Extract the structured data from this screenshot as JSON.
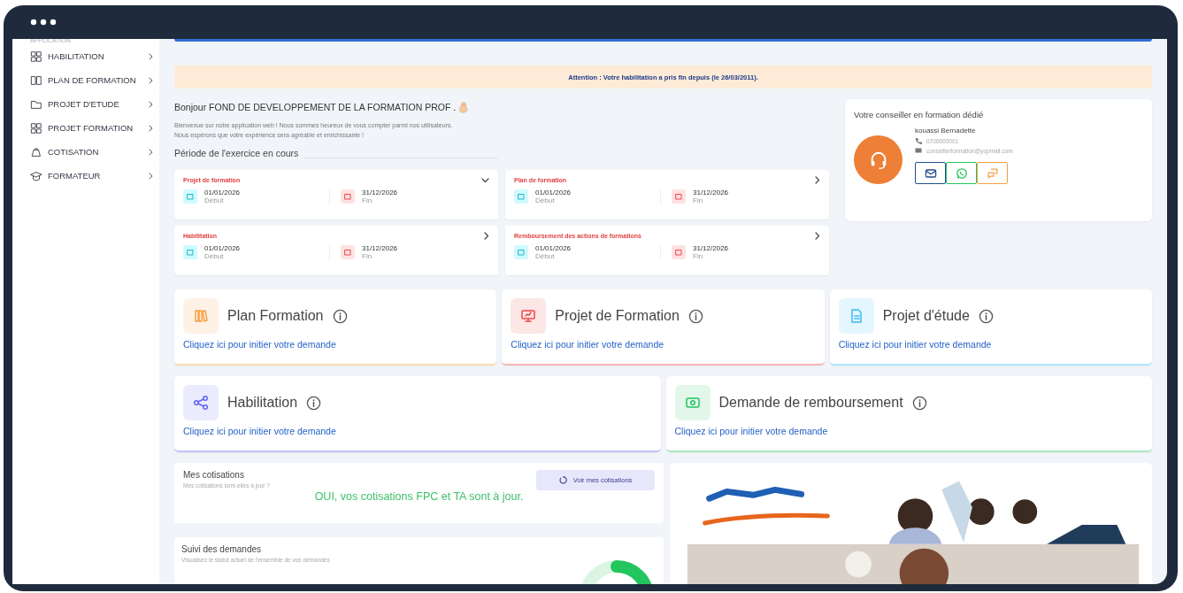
{
  "sidebar": {
    "section": "APPLICATION",
    "items": [
      {
        "label": "HABILITATION"
      },
      {
        "label": "PLAN DE FORMATION"
      },
      {
        "label": "PROJET D'ETUDE"
      },
      {
        "label": "PROJET FORMATION"
      },
      {
        "label": "COTISATION"
      },
      {
        "label": "FORMATEUR"
      }
    ]
  },
  "alert": "Attention : Votre habilitation a pris fin depuis (le 26/03/2011).",
  "greeting": {
    "title": "Bonjour FOND DE DEVELOPPEMENT DE LA FORMATION PROF .",
    "lines": [
      "Bienvenue sur notre application web ! Nous sommes heureux de vous compter parmi nos utilisateurs.",
      "Nous espérons que votre expérience sera agréable et enrichissante !"
    ]
  },
  "period": {
    "title": "Période de l'exercice en cours",
    "cards": [
      {
        "title": "Projet de formation",
        "expanded": true,
        "start": "01/01/2026",
        "start_label": "Début",
        "end": "31/12/2026",
        "end_label": "Fin"
      },
      {
        "title": "Plan de formation",
        "expanded": false,
        "start": "01/01/2026",
        "start_label": "Début",
        "end": "31/12/2026",
        "end_label": "Fin"
      },
      {
        "title": "Habilitation",
        "expanded": false,
        "start": "01/01/2026",
        "start_label": "Début",
        "end": "31/12/2026",
        "end_label": "Fin"
      },
      {
        "title": "Remboursement des actions de formations",
        "expanded": false,
        "start": "01/01/2026",
        "start_label": "Début",
        "end": "31/12/2026",
        "end_label": "Fin"
      }
    ]
  },
  "advisor": {
    "title": "Votre conseiller en formation dédié",
    "name": "kouassi Bernadette",
    "phone": "0700000001",
    "email": "conseillerformation@yopmail.com"
  },
  "actions": [
    {
      "title": "Plan Formation",
      "link": "Cliquez ici pour initier votre demande",
      "color": "#f59e42"
    },
    {
      "title": "Projet de Formation",
      "link": "Cliquez ici pour initier votre demande",
      "color": "#ef4444"
    },
    {
      "title": "Projet d'étude",
      "link": "Cliquez ici pour initier votre demande",
      "color": "#38bdf8"
    },
    {
      "title": "Habilitation",
      "link": "Cliquez ici pour initier votre demande",
      "color": "#6366f1"
    },
    {
      "title": "Demande de remboursement",
      "link": "Cliquez ici pour initier votre demande",
      "color": "#22c55e"
    }
  ],
  "cotisations": {
    "title": "Mes cotisations",
    "subtitle": "Mes cotisations sont-elles à jour ?",
    "button": "Voir mes cotisations",
    "status": "OUI, vos cotisations FPC et TA sont à jour."
  },
  "suivi": {
    "title": "Suivi des demandes",
    "subtitle": "Visualisez le statut actuel de l'ensemble de vos demandes"
  }
}
